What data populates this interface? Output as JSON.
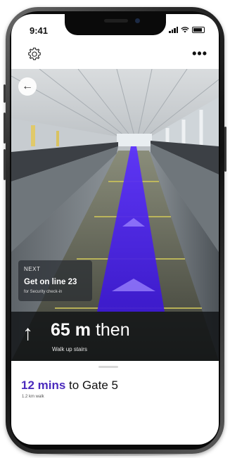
{
  "status_bar": {
    "time": "9:41",
    "icons": [
      "signal-icon",
      "wifi-icon",
      "battery-icon"
    ]
  },
  "top_bar": {
    "settings_icon": "gear-icon",
    "more_label": "•••"
  },
  "camera_view": {
    "back_icon": "arrow-left-icon",
    "path_color": "#4a1fe0"
  },
  "next_card": {
    "label": "NEXT",
    "title": "Get on line 23",
    "subtitle": "for Security check-in"
  },
  "instruction": {
    "arrow_icon": "arrow-up-icon",
    "distance": "65 m",
    "then_text": "then",
    "subtitle": "Walk up stairs"
  },
  "bottom_sheet": {
    "eta_minutes": "12 mins",
    "eta_destination": "to Gate 5",
    "eta_distance": "1.2 km walk",
    "accent_color": "#4b2bbd"
  }
}
